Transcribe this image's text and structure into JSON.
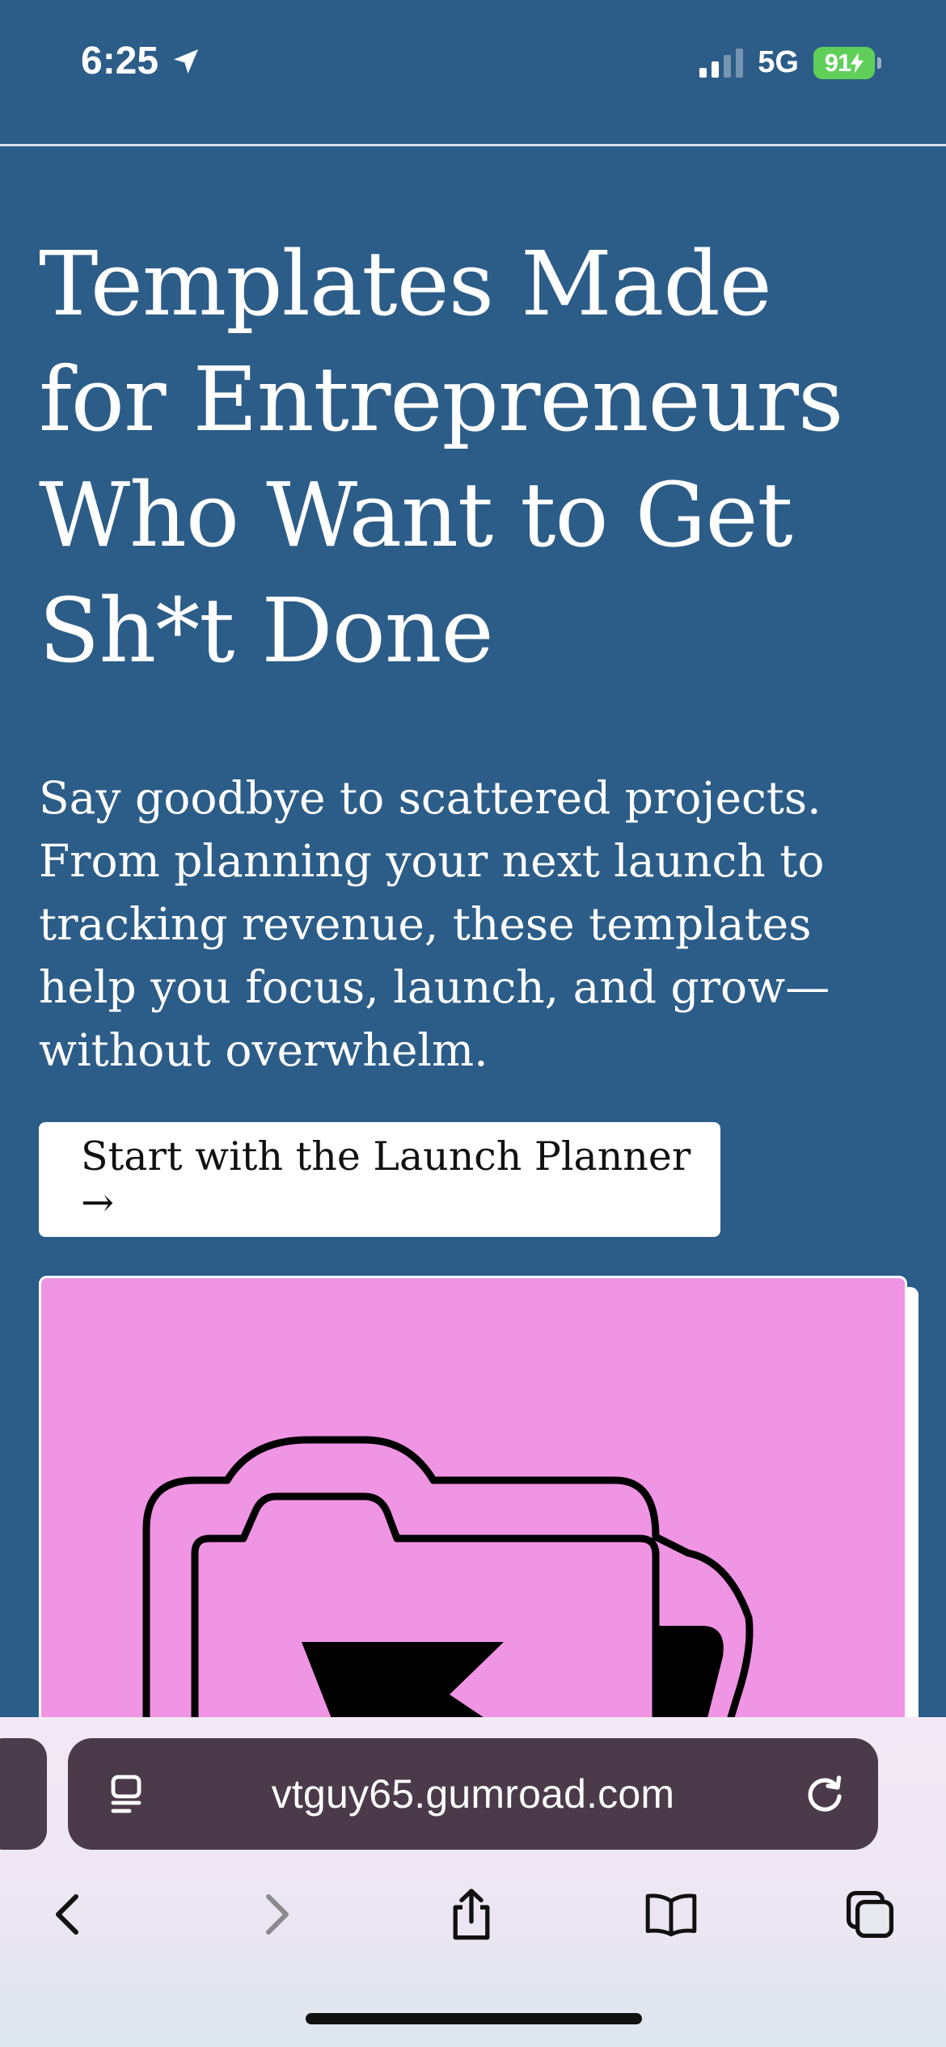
{
  "status_bar": {
    "time": "6:25",
    "network": "5G",
    "battery": "91"
  },
  "hero": {
    "title": "Templates Made for Entrepreneurs Who Want to Get Sh*t Done",
    "description": "Say goodbye to scattered projects. From planning your next launch to tracking revenue, these templates help you focus, launch, and grow—without overwhelm.",
    "cta_label": "Start with the Launch Planner →"
  },
  "product_card": {
    "background_color": "#f094e4",
    "icon": "folder-icon"
  },
  "browser": {
    "url": "vtguy65.gumroad.com",
    "icons": [
      "reader-icon",
      "reload-icon",
      "back-icon",
      "forward-icon",
      "share-icon",
      "bookmarks-icon",
      "tabs-icon"
    ]
  },
  "colors": {
    "page_background": "#2c5d88",
    "battery": "#5fcf5a"
  }
}
